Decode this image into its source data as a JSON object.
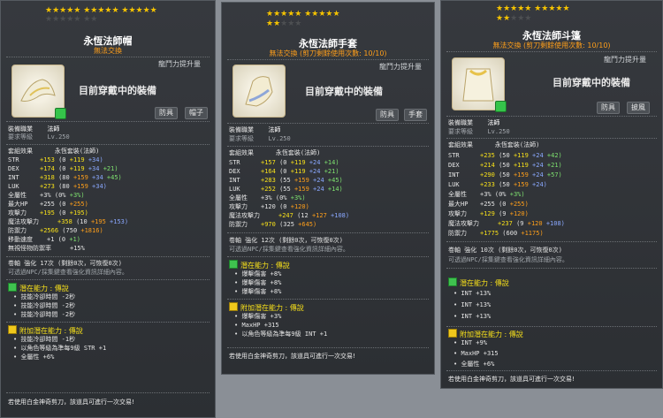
{
  "panels": [
    {
      "stars_on": 15,
      "stars_off": 7,
      "title": "永恆法師帽",
      "no_trade": "無法交換",
      "dragon": "龍鬥力提升量",
      "wearing": "目前穿戴中的裝備",
      "chips": [
        "防具",
        "帽子"
      ],
      "job_label": "裝備職業",
      "job_value": "法師",
      "req_label": "要求等級",
      "req_value": "Lv.250",
      "set_label": "套組效果",
      "set_value": "永恆套裝(法師)",
      "stats": [
        [
          "STR",
          "+153",
          "(0",
          "+119",
          "+34)"
        ],
        [
          "DEX",
          "+174",
          "(0",
          "+119",
          "+34",
          "+21)"
        ],
        [
          "INT",
          "+318",
          "(80",
          "+159",
          "+34",
          "+45)"
        ],
        [
          "LUK",
          "+273",
          "(80",
          "+159",
          "+34)"
        ],
        [
          "全屬性",
          "+3%",
          "(0%",
          "+3%)"
        ],
        [
          "最大HP",
          "+255",
          "(0",
          "+255)"
        ],
        [
          "攻擊力",
          "+195",
          "(0",
          "+195)"
        ],
        [
          "魔法攻擊力",
          "+358",
          "(10",
          "+195",
          "+153)"
        ],
        [
          "防禦力",
          "+2566",
          "(750",
          "+1816)"
        ],
        [
          "移動速度",
          "+1",
          "(0",
          "+1)"
        ],
        [
          "無視怪物防禦率",
          "+15%"
        ]
      ],
      "scroll_a": "卷軸 強化 17次 (剩餘0次，可恢復0次)",
      "scroll_b": "可透過NPC/採集鍵查看強化資訊詳細內容。",
      "pot_title": "潛在能力 : 傳說",
      "pot_lines": [
        "技能冷卻時間 -2秒",
        "技能冷卻時間 -2秒",
        "技能冷卻時間 -2秒"
      ],
      "add_title": "附加潛在能力 : 傳說",
      "add_lines": [
        "技能冷卻時間 -1秒",
        "以角色等級為準每9級 STR +1",
        "全屬性 +6%"
      ],
      "bottom": "若使用白金神奇剪刀，該道具可進行一次交易!"
    },
    {
      "stars_on": 12,
      "stars_off": 3,
      "title": "永恆法師手套",
      "no_trade": "無法交換 (剪刀剩餘使用次數: 10/10)",
      "dragon": "龍鬥力提升量",
      "wearing": "目前穿戴中的裝備",
      "chips": [
        "防具",
        "手套"
      ],
      "job_label": "裝備職業",
      "job_value": "法師",
      "req_label": "要求等級",
      "req_value": "Lv.250",
      "set_label": "套組效果",
      "set_value": "永恆套裝(法師)",
      "stats": [
        [
          "STR",
          "+157",
          "(0",
          "+119",
          "+24",
          "+14)"
        ],
        [
          "DEX",
          "+164",
          "(0",
          "+119",
          "+24",
          "+21)"
        ],
        [
          "INT",
          "+283",
          "(55",
          "+159",
          "+24",
          "+45)"
        ],
        [
          "LUK",
          "+252",
          "(55",
          "+159",
          "+24",
          "+14)"
        ],
        [
          "全屬性",
          "+3%",
          "(0%",
          "+3%)"
        ],
        [
          "攻擊力",
          "+120",
          "(0",
          "+120)"
        ],
        [
          "魔法攻擊力",
          "+247",
          "(12",
          "+127",
          "+108)"
        ],
        [
          "防禦力",
          "+970",
          "(325",
          "+645)"
        ]
      ],
      "scroll_a": "卷軸 強化 12次 (剩餘0次，可恢復0次)",
      "scroll_b": "可透過NPC/採集鍵查看強化資訊詳細內容。",
      "pot_title": "潛在能力 : 傳說",
      "pot_lines": [
        "爆擊傷害 +8%",
        "爆擊傷害 +8%",
        "爆擊傷害 +8%"
      ],
      "add_title": "附加潛在能力 : 傳說",
      "add_lines": [
        "爆擊傷害 +3%",
        "MaxHP +315",
        "以角色等級為準每9級 INT +1"
      ],
      "bottom": "若使用白金神奇剪刀，該道具可進行一次交易!"
    },
    {
      "stars_on": 12,
      "stars_off": 3,
      "title": "永恆法師斗篷",
      "no_trade": "無法交換 (剪刀剩餘使用次數: 10/10)",
      "dragon": "龍鬥力提升量",
      "wearing": "目前穿戴中的裝備",
      "chips": [
        "防具",
        "披風"
      ],
      "job_label": "裝備職業",
      "job_value": "法師",
      "req_label": "要求等級",
      "req_value": "Lv.250",
      "set_label": "套組效果",
      "set_value": "永恆套裝(法師)",
      "stats": [
        [
          "STR",
          "+235",
          "(50",
          "+119",
          "+24",
          "+42)"
        ],
        [
          "DEX",
          "+214",
          "(50",
          "+119",
          "+24",
          "+21)"
        ],
        [
          "INT",
          "+290",
          "(50",
          "+159",
          "+24",
          "+57)"
        ],
        [
          "LUK",
          "+233",
          "(50",
          "+159",
          "+24)"
        ],
        [
          "全屬性",
          "+3%",
          "(0%",
          "+3%)"
        ],
        [
          "最大HP",
          "+255",
          "(0",
          "+255)"
        ],
        [
          "攻擊力",
          "+129",
          "(9",
          "+120)"
        ],
        [
          "魔法攻擊力",
          "+237",
          "(9",
          "+120",
          "+108)"
        ],
        [
          "防禦力",
          "+1775",
          "(600",
          "+1175)"
        ]
      ],
      "scroll_a": "卷軸 強化 10次 (剩餘0次，可恢復0次)",
      "scroll_b": "可透過NPC/採集鍵查看強化資訊詳細內容。",
      "pot_title": "潛在能力 : 傳說",
      "pot_lines": [
        "INT +13%",
        "INT +13%",
        "INT +13%"
      ],
      "add_title": "附加潛在能力 : 傳說",
      "add_lines": [
        "INT +9%",
        "MaxHP +315",
        "全屬性 +6%"
      ],
      "bottom": "若使用白金神奇剪刀，該道具可進行一次交易!"
    }
  ],
  "colors": {
    "star_on": "#f5c300",
    "star_off": "#4d4f52",
    "no_trade": "#ff9f1a",
    "potential": "#f7e01a",
    "bonus_green": "#7ee16f"
  }
}
